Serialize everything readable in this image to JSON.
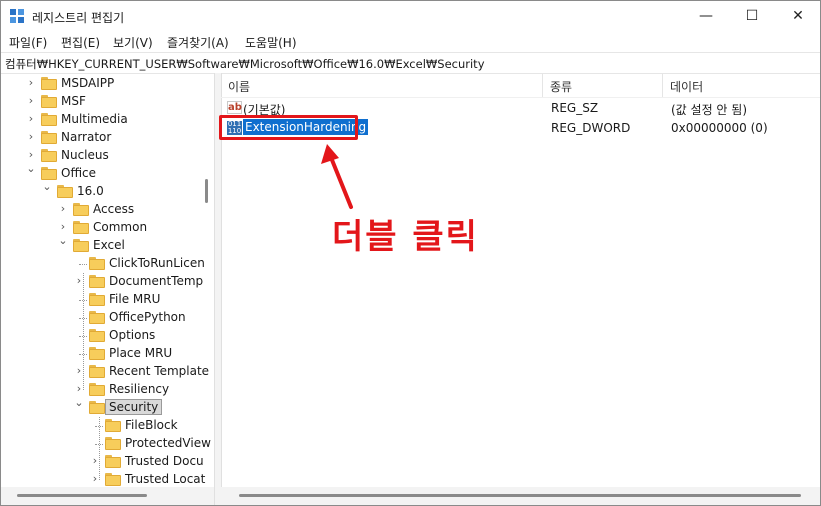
{
  "window": {
    "title": "레지스트리 편집기",
    "controls": {
      "minimize": "—",
      "maximize": "☐",
      "close": "✕"
    }
  },
  "menu": [
    "파일(F)",
    "편집(E)",
    "보기(V)",
    "즐겨찾기(A)",
    "도움말(H)"
  ],
  "address": "컴퓨터₩HKEY_CURRENT_USER₩Software₩Microsoft₩Office₩16.0₩Excel₩Security",
  "tree": [
    {
      "label": "MSDAIPP",
      "level": 0,
      "chevron": "›"
    },
    {
      "label": "MSF",
      "level": 0,
      "chevron": "›"
    },
    {
      "label": "Multimedia",
      "level": 0,
      "chevron": "›"
    },
    {
      "label": "Narrator",
      "level": 0,
      "chevron": "›"
    },
    {
      "label": "Nucleus",
      "level": 0,
      "chevron": "›"
    },
    {
      "label": "Office",
      "level": 0,
      "chevron": "⌄"
    },
    {
      "label": "16.0",
      "level": 1,
      "chevron": "⌄"
    },
    {
      "label": "Access",
      "level": 2,
      "chevron": "›"
    },
    {
      "label": "Common",
      "level": 2,
      "chevron": "›"
    },
    {
      "label": "Excel",
      "level": 2,
      "chevron": "⌄"
    },
    {
      "label": "ClickToRunLicen",
      "level": 3,
      "chevron": ""
    },
    {
      "label": "DocumentTemp",
      "level": 3,
      "chevron": "›"
    },
    {
      "label": "File MRU",
      "level": 3,
      "chevron": ""
    },
    {
      "label": "OfficePython",
      "level": 3,
      "chevron": ""
    },
    {
      "label": "Options",
      "level": 3,
      "chevron": ""
    },
    {
      "label": "Place MRU",
      "level": 3,
      "chevron": ""
    },
    {
      "label": "Recent Template",
      "level": 3,
      "chevron": "›"
    },
    {
      "label": "Resiliency",
      "level": 3,
      "chevron": "›"
    },
    {
      "label": "Security",
      "level": 3,
      "chevron": "⌄",
      "selected": true
    },
    {
      "label": "FileBlock",
      "level": 4,
      "chevron": ""
    },
    {
      "label": "ProtectedView",
      "level": 4,
      "chevron": ""
    },
    {
      "label": "Trusted Docu",
      "level": 4,
      "chevron": "›"
    },
    {
      "label": "Trusted Locat",
      "level": 4,
      "chevron": "›"
    }
  ],
  "list": {
    "columns": [
      "이름",
      "종류",
      "데이터"
    ],
    "rows": [
      {
        "icon": "string-value-icon",
        "icon_text": "ab",
        "name": "(기본값)",
        "type": "REG_SZ",
        "data": "(값 설정 안 됨)"
      },
      {
        "icon": "binary-value-icon",
        "icon_text": "011 110",
        "name": "ExtensionHardening",
        "type": "REG_DWORD",
        "data": "0x00000000 (0)",
        "selected": true
      }
    ]
  },
  "annotation": {
    "text": "더블 클릭",
    "color": "#e3161a"
  },
  "colors": {
    "selection": "#0f6fcf",
    "folder": "#f7cd5b",
    "highlight": "#e3161a"
  }
}
